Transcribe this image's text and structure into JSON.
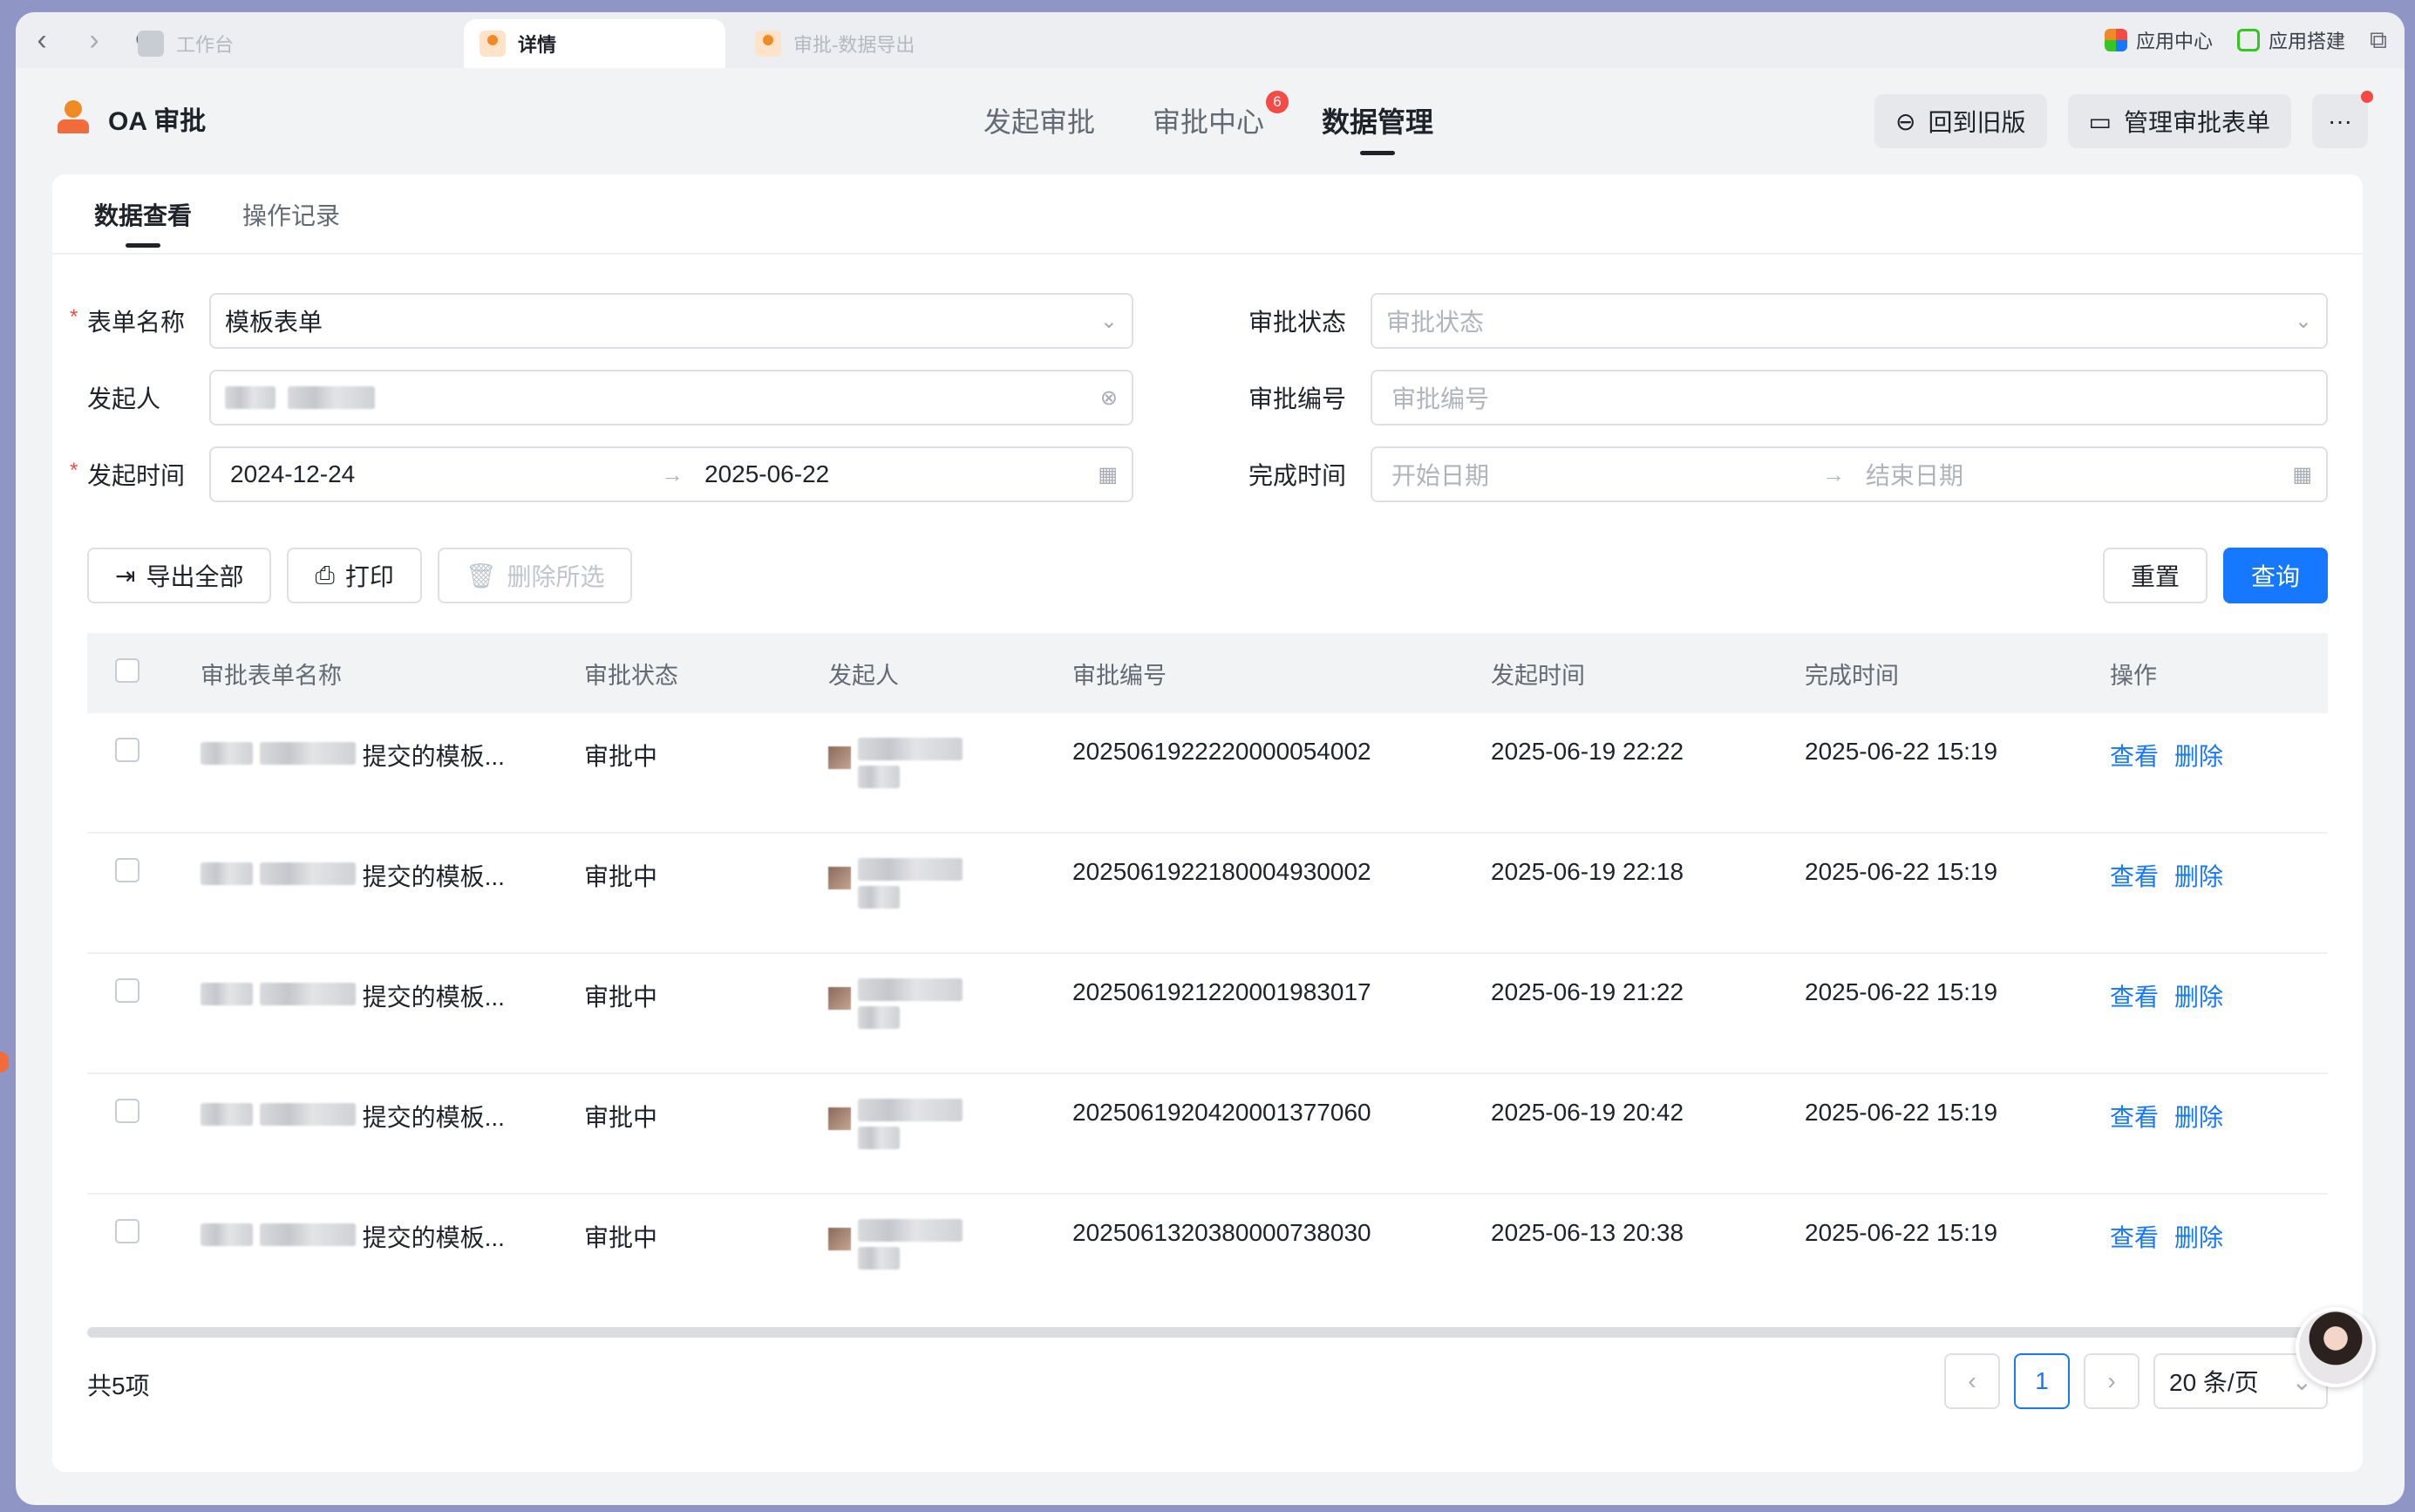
{
  "browser_tabs": [
    {
      "label": "工作台",
      "active": false
    },
    {
      "label": "详情",
      "active": true
    },
    {
      "label": "审批-数据导出",
      "active": false
    }
  ],
  "browser_links": [
    "应用中心",
    "应用搭建"
  ],
  "app": {
    "title": "OA 审批"
  },
  "main_nav": [
    {
      "label": "发起审批",
      "active": false
    },
    {
      "label": "审批中心",
      "active": false,
      "badge": "6"
    },
    {
      "label": "数据管理",
      "active": true
    }
  ],
  "header_buttons": {
    "back_old": "回到旧版",
    "manage_forms": "管理审批表单"
  },
  "subtabs": [
    {
      "label": "数据查看",
      "active": true
    },
    {
      "label": "操作记录",
      "active": false
    }
  ],
  "filters": {
    "form_name": {
      "label": "表单名称",
      "value": "模板表单",
      "required": true
    },
    "status": {
      "label": "审批状态",
      "placeholder": "审批状态"
    },
    "initiator": {
      "label": "发起人"
    },
    "approval_no": {
      "label": "审批编号",
      "placeholder": "审批编号"
    },
    "start_time": {
      "label": "发起时间",
      "from": "2024-12-24",
      "to": "2025-06-22",
      "required": true
    },
    "finish_time": {
      "label": "完成时间",
      "from_placeholder": "开始日期",
      "to_placeholder": "结束日期"
    }
  },
  "actions": {
    "export_all": "导出全部",
    "print": "打印",
    "delete_selected": "删除所选",
    "reset": "重置",
    "query": "查询"
  },
  "table": {
    "columns": [
      "审批表单名称",
      "审批状态",
      "发起人",
      "审批编号",
      "发起时间",
      "完成时间",
      "操作"
    ],
    "rows": [
      {
        "name_suffix": "提交的模板...",
        "status": "审批中",
        "no": "2025061922220000054002",
        "start": "2025-06-19 22:22",
        "finish": "2025-06-22 15:19"
      },
      {
        "name_suffix": "提交的模板...",
        "status": "审批中",
        "no": "2025061922180004930002",
        "start": "2025-06-19 22:18",
        "finish": "2025-06-22 15:19"
      },
      {
        "name_suffix": "提交的模板...",
        "status": "审批中",
        "no": "2025061921220001983017",
        "start": "2025-06-19 21:22",
        "finish": "2025-06-22 15:19"
      },
      {
        "name_suffix": "提交的模板...",
        "status": "审批中",
        "no": "2025061920420001377060",
        "start": "2025-06-19 20:42",
        "finish": "2025-06-22 15:19"
      },
      {
        "name_suffix": "提交的模板...",
        "status": "审批中",
        "no": "2025061320380000738030",
        "start": "2025-06-13 20:38",
        "finish": "2025-06-22 15:19"
      }
    ],
    "row_actions": {
      "view": "查看",
      "delete": "删除"
    }
  },
  "pagination": {
    "total": "共5项",
    "current": "1",
    "page_size": "20 条/页"
  },
  "colors": {
    "primary": "#1677ff",
    "badge": "#f54a45",
    "brand": "#f08a24"
  }
}
